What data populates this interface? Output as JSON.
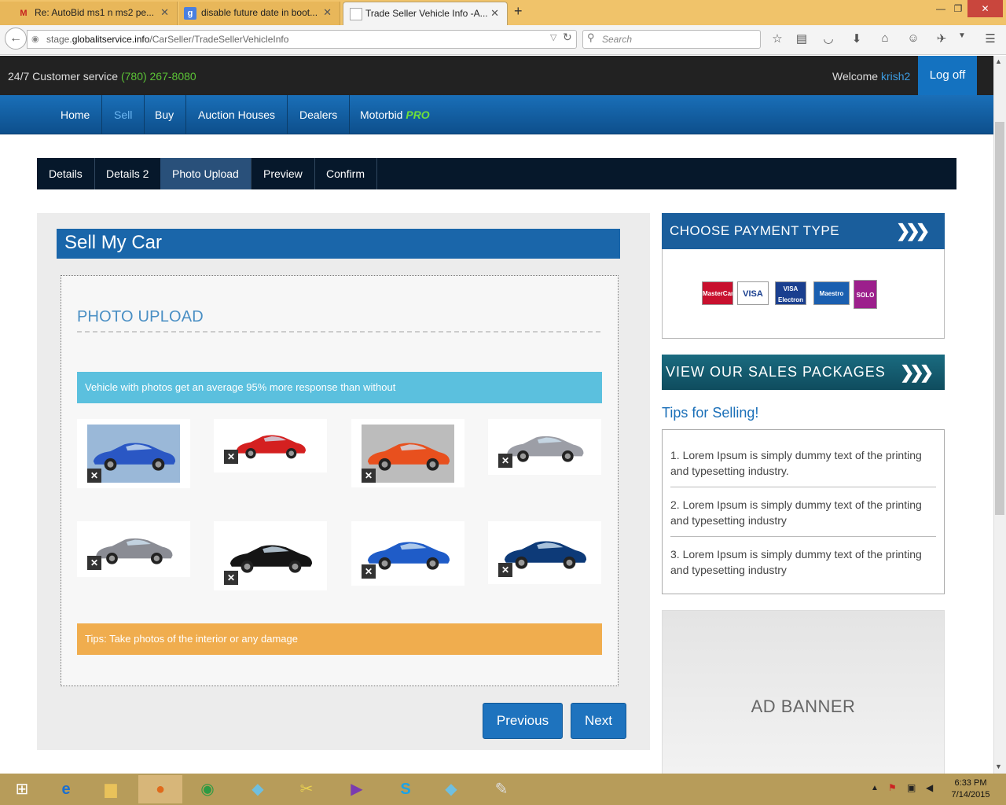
{
  "browser": {
    "tabs": [
      {
        "label": "Re: AutoBid ms1 n ms2 pe...",
        "icon": "gmail-icon"
      },
      {
        "label": "disable future date in boot...",
        "icon": "google-icon"
      },
      {
        "label": "Trade Seller Vehicle Info -A...",
        "icon": "page-icon"
      }
    ],
    "url_prefix": "stage.",
    "url_domain": "globalitservice.info",
    "url_path": "/CarSeller/TradeSellerVehicleInfo",
    "search_placeholder": "Search"
  },
  "topbar": {
    "customer_service": "24/7 Customer service",
    "phone": "(780) 267-8080",
    "welcome": "Welcome",
    "username": "krish2",
    "logoff": "Log off"
  },
  "nav": {
    "home": "Home",
    "sell": "Sell",
    "buy": "Buy",
    "auction": "Auction Houses",
    "dealers": "Dealers",
    "motorbid": "Motorbid",
    "pro": "PRO"
  },
  "steps": {
    "details": "Details",
    "details2": "Details 2",
    "photo": "Photo Upload",
    "preview": "Preview",
    "confirm": "Confirm"
  },
  "main": {
    "title": "Sell My Car",
    "section_title": "PHOTO UPLOAD",
    "info": "Vehicle with photos get an average 95% more response than without",
    "tip": "Tips: Take photos of the interior or any damage",
    "previous": "Previous",
    "next": "Next",
    "photos": [
      {
        "color": "#2a57c4",
        "bg": "#9ab8d8"
      },
      {
        "color": "#d42020",
        "bg": "#ffffff"
      },
      {
        "color": "#e8501e",
        "bg": "#bcbcbc"
      },
      {
        "color": "#9c9ea6",
        "bg": "#ffffff"
      },
      {
        "color": "#8a8c94",
        "bg": "#ffffff"
      },
      {
        "color": "#151515",
        "bg": "#ffffff"
      },
      {
        "color": "#1f5cc8",
        "bg": "#ffffff"
      },
      {
        "color": "#0d3a78",
        "bg": "#ffffff"
      }
    ]
  },
  "sidebar": {
    "payment_title": "CHOOSE PAYMENT TYPE",
    "cards": [
      {
        "label": "MasterCard",
        "color": "#c8102e"
      },
      {
        "label": "VISA",
        "color": "#1a3f8f"
      },
      {
        "label": "VISA Electron",
        "color": "#1a3f8f"
      },
      {
        "label": "Maestro",
        "color": "#d81e2a"
      },
      {
        "label": "SOLO",
        "color": "#9c1f8c"
      }
    ],
    "packages_title": "VIEW OUR SALES PACKAGES",
    "tips_title": "Tips for Selling!",
    "tips": [
      "1. Lorem Ipsum is simply dummy text of the printing and typesetting industry.",
      "2. Lorem Ipsum is simply dummy text of the printing and typesetting industry",
      "3. Lorem Ipsum is simply dummy text of the printing and typesetting industry"
    ],
    "ad": "AD BANNER"
  },
  "taskbar": {
    "time": "6:33 PM",
    "date": "7/14/2015"
  }
}
